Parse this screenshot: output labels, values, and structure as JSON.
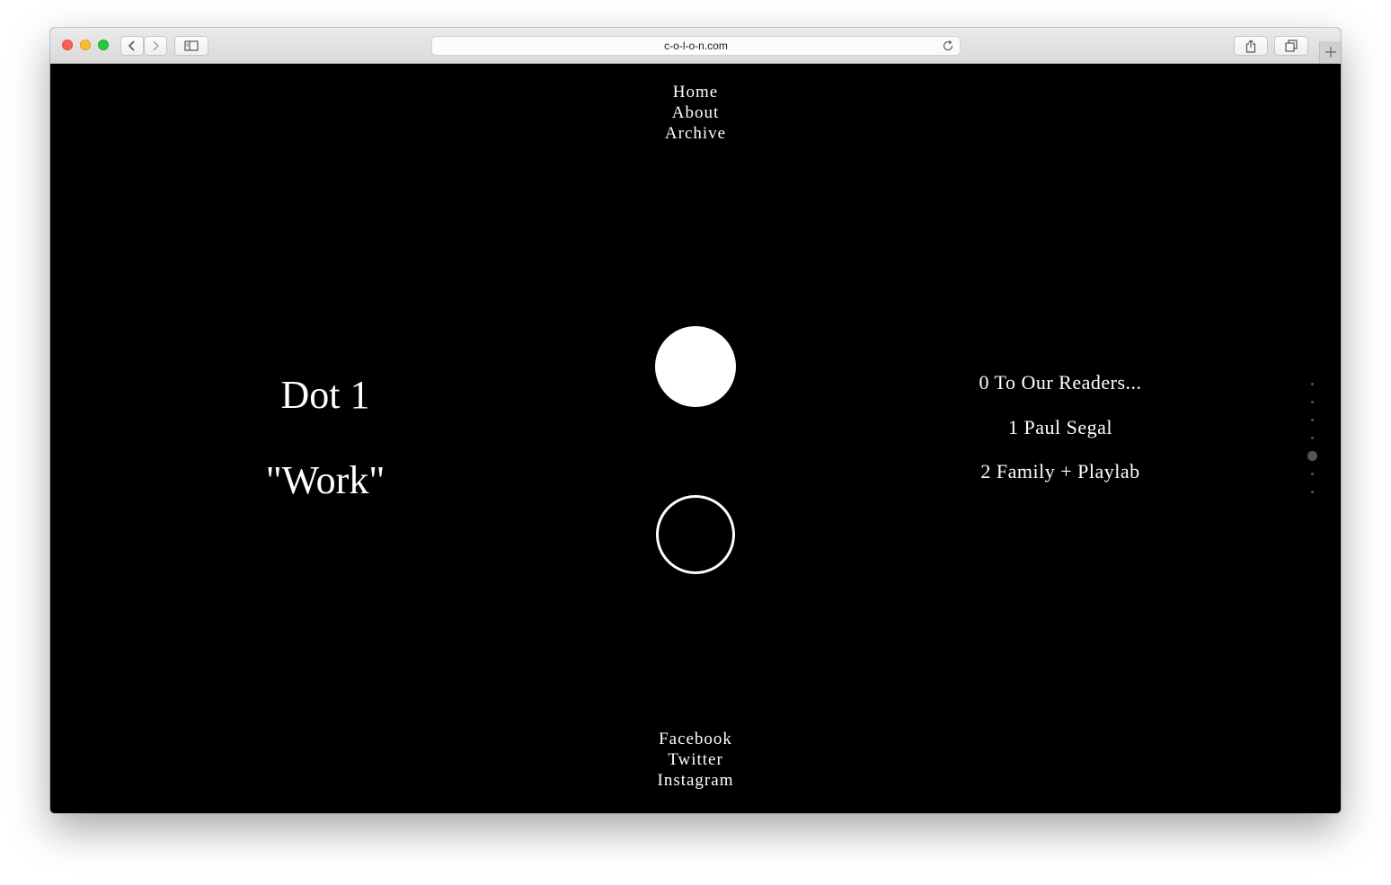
{
  "browser": {
    "url": "c-o-l-o-n.com",
    "icons": {
      "back": "chevron-left-icon",
      "forward": "chevron-right-icon",
      "sidebar": "sidebar-icon",
      "reload": "reload-icon",
      "share": "share-icon",
      "tabs": "tabs-icon",
      "new_tab": "plus-icon"
    }
  },
  "nav": {
    "top": [
      "Home",
      "About",
      "Archive"
    ],
    "bottom": [
      "Facebook",
      "Twitter",
      "Instagram"
    ]
  },
  "main": {
    "title": "Dot 1",
    "subtitle": "\"Work\"",
    "entries": [
      "0 To Our Readers...",
      "1 Paul Segal",
      "2 Family + Playlab"
    ]
  },
  "pager": {
    "count": 7,
    "active_index": 4
  },
  "colors": {
    "background": "#000000",
    "text": "#ffffff",
    "pager_dot": "#555555"
  }
}
